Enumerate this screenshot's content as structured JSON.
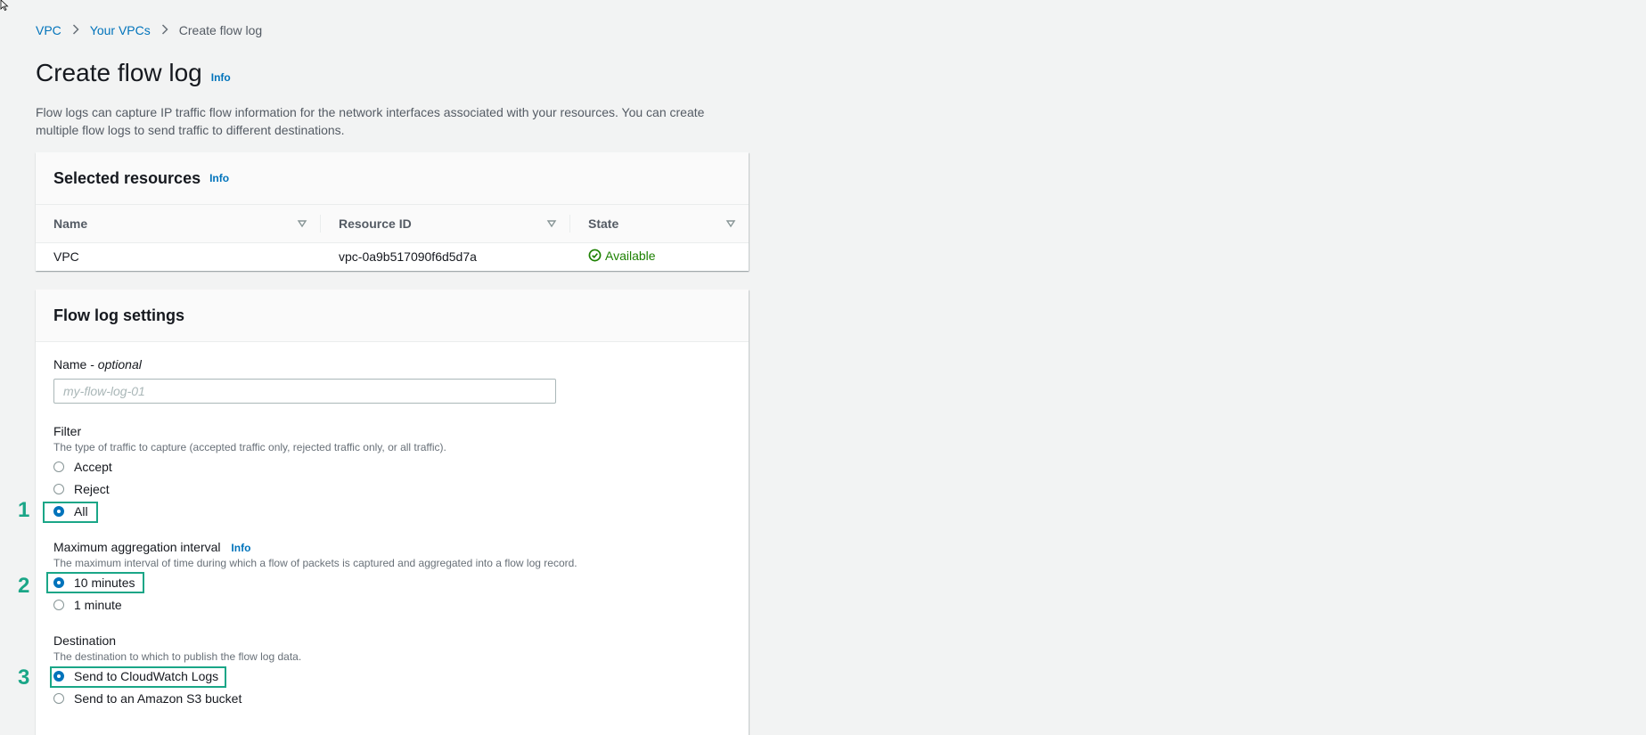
{
  "breadcrumb": {
    "items": [
      {
        "label": "VPC"
      },
      {
        "label": "Your VPCs"
      },
      {
        "label": "Create flow log"
      }
    ]
  },
  "page": {
    "title": "Create flow log",
    "info": "Info",
    "description": "Flow logs can capture IP traffic flow information for the network interfaces associated with your resources. You can create multiple flow logs to send traffic to different destinations."
  },
  "selected_resources": {
    "title": "Selected resources",
    "info": "Info",
    "columns": [
      "Name",
      "Resource ID",
      "State"
    ],
    "rows": [
      {
        "name": "VPC",
        "resource_id": "vpc-0a9b517090f6d5d7a",
        "state": "Available"
      }
    ]
  },
  "flow_log_settings": {
    "title": "Flow log settings",
    "name_label": "Name - ",
    "name_optional": "optional",
    "name_placeholder": "my-flow-log-01",
    "name_value": "",
    "filter": {
      "label": "Filter",
      "description": "The type of traffic to capture (accepted traffic only, rejected traffic only, or all traffic).",
      "options": [
        "Accept",
        "Reject",
        "All"
      ],
      "selected": "All"
    },
    "aggregation": {
      "label": "Maximum aggregation interval",
      "info": "Info",
      "description": "The maximum interval of time during which a flow of packets is captured and aggregated into a flow log record.",
      "options": [
        "10 minutes",
        "1 minute"
      ],
      "selected": "10 minutes"
    },
    "destination": {
      "label": "Destination",
      "description": "The destination to which to publish the flow log data.",
      "options": [
        "Send to CloudWatch Logs",
        "Send to an Amazon S3 bucket"
      ],
      "selected": "Send to CloudWatch Logs"
    }
  },
  "annotations": {
    "step1": "1",
    "step2": "2",
    "step3": "3",
    "color": "#1aa687"
  },
  "colors": {
    "link": "#0073bb",
    "available": "#1d8102",
    "background": "#f2f3f3"
  }
}
